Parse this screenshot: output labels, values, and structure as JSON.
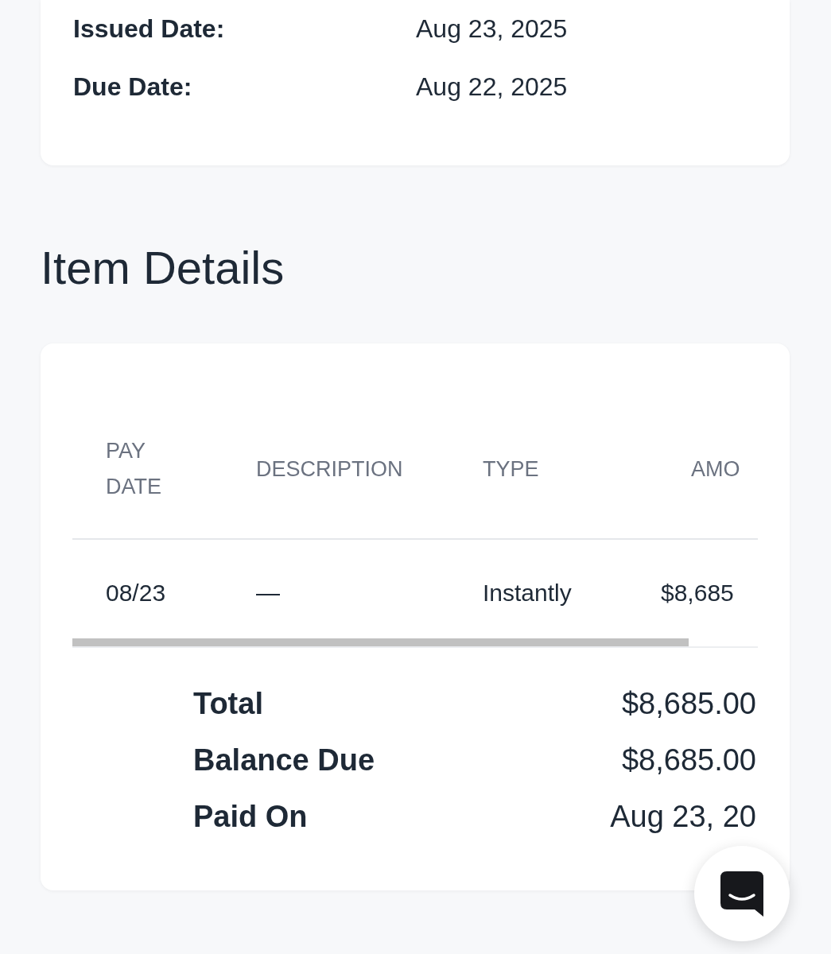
{
  "invoice_details": [
    {
      "label": "Issued Date:",
      "value": "Aug 23, 2025"
    },
    {
      "label": "Due Date:",
      "value": "Aug 22, 2025"
    }
  ],
  "item_details": {
    "title": "Item Details",
    "table": {
      "columns": [
        "PAY DATE",
        "DESCRIPTION",
        "TYPE",
        "AMO"
      ],
      "rows": [
        [
          "08/23",
          "—",
          "Instantly",
          "$8,685"
        ]
      ]
    },
    "summary": [
      {
        "label": "Total",
        "value": "$8,685.00"
      },
      {
        "label": "Balance Due",
        "value": "$8,685.00"
      },
      {
        "label": "Paid On",
        "value": "Aug 23, 20"
      }
    ]
  }
}
